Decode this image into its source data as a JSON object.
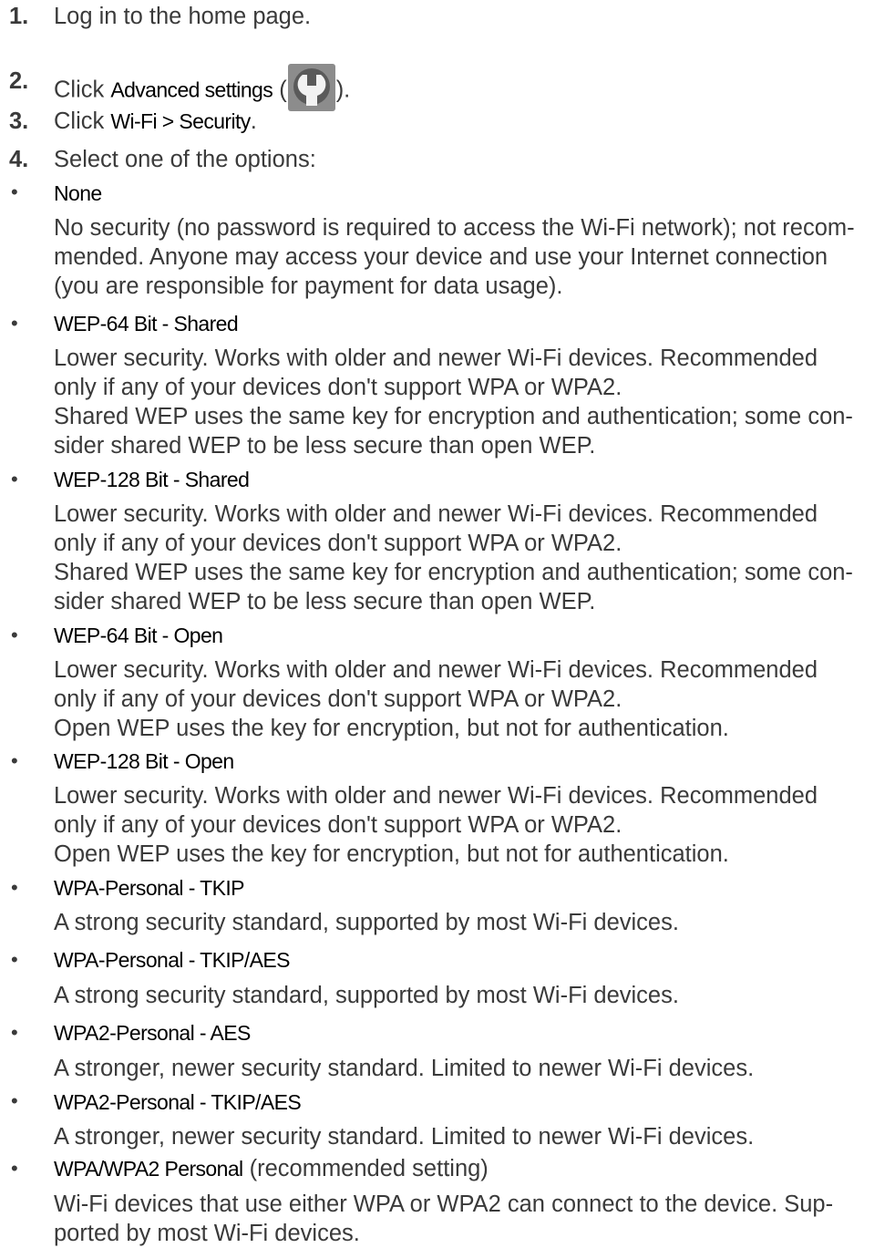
{
  "steps": [
    {
      "number": "1.",
      "text": "Log in to the home page."
    },
    {
      "number": "2.",
      "prefix": "Click ",
      "ui": "Advanced settings",
      "paren_open": " (",
      "icon": "wrench-icon",
      "paren_close": ")."
    },
    {
      "number": "3.",
      "prefix": "Click ",
      "ui": "Wi-Fi > Security",
      "suffix": "."
    },
    {
      "number": "4.",
      "text": "Select one of the options:"
    }
  ],
  "options": [
    {
      "bullet": "•",
      "name": "None",
      "desc": [
        "No security (no password is required to access the Wi-Fi network); not recom-",
        "mended. Anyone may access your device and use your Internet connection",
        "(you are responsible for payment for data usage)."
      ]
    },
    {
      "bullet": "•",
      "name": "WEP-64 Bit - Shared",
      "desc": [
        "Lower security. Works with older and newer Wi-Fi devices. Recommended",
        "only if any of your devices don't support WPA or WPA2.",
        "Shared WEP uses the same key for encryption and authentication; some con-",
        "sider shared WEP to be less secure than open WEP."
      ]
    },
    {
      "bullet": "•",
      "name": "WEP-128 Bit - Shared",
      "desc": [
        "Lower security. Works with older and newer Wi-Fi devices. Recommended",
        "only if any of your devices don't support WPA or WPA2.",
        "Shared WEP uses the same key for encryption and authentication; some con-",
        "sider shared WEP to be less secure than open WEP."
      ]
    },
    {
      "bullet": "•",
      "name": "WEP-64 Bit - Open",
      "desc": [
        "Lower security. Works with older and newer Wi-Fi devices. Recommended",
        "only if any of your devices don't support WPA or WPA2.",
        "Open WEP uses the key for encryption, but not for authentication."
      ]
    },
    {
      "bullet": "•",
      "name": "WEP-128 Bit - Open",
      "desc": [
        "Lower security. Works with older and newer Wi-Fi devices. Recommended",
        "only if any of your devices don't support WPA or WPA2.",
        "Open WEP uses the key for encryption, but not for authentication."
      ]
    },
    {
      "bullet": "•",
      "name": "WPA-Personal - TKIP",
      "desc": [
        "A strong security standard, supported by most Wi-Fi devices."
      ]
    },
    {
      "bullet": "•",
      "name": "WPA-Personal - TKIP/AES",
      "desc": [
        "A strong security standard, supported by most Wi-Fi devices."
      ]
    },
    {
      "bullet": "•",
      "name": "WPA2-Personal - AES",
      "desc": [
        "A stronger, newer security standard. Limited to newer Wi-Fi devices."
      ]
    },
    {
      "bullet": "•",
      "name": "WPA2-Personal - TKIP/AES",
      "desc": [
        "A stronger, newer security standard. Limited to newer Wi-Fi devices."
      ]
    },
    {
      "bullet": "•",
      "name": "WPA/WPA2 Personal",
      "note": " (recommended setting)",
      "desc": [
        "Wi-Fi devices that use either WPA or WPA2 can connect to the device. Sup-",
        "ported by most Wi-Fi devices."
      ]
    }
  ]
}
